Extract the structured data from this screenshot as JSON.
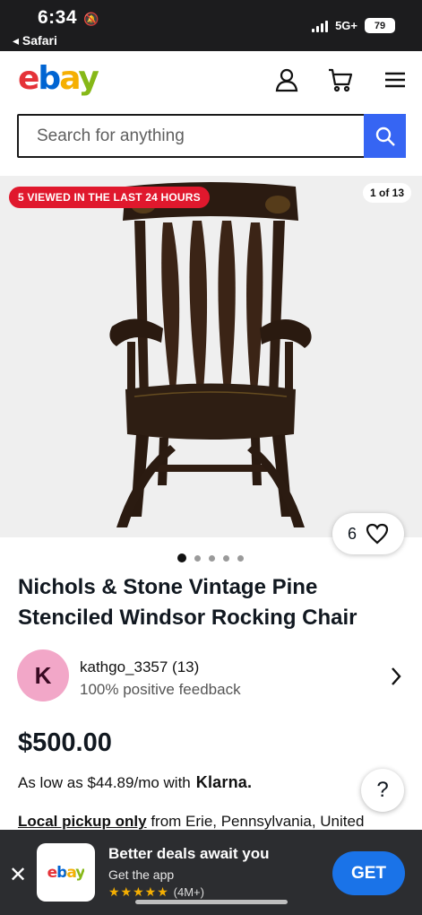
{
  "status_bar": {
    "time": "6:34",
    "back_label": "◂ Safari",
    "network": "5G+",
    "battery": "79"
  },
  "header": {
    "logo_letters": [
      "e",
      "b",
      "a",
      "y"
    ],
    "search_placeholder": "Search for anything"
  },
  "gallery": {
    "badge": "5 VIEWED IN THE LAST 24 HOURS",
    "counter": "1 of 13",
    "watch_count": "6",
    "dots_total": 5,
    "dots_active": 1
  },
  "listing": {
    "title": "Nichols & Stone Vintage Pine Stenciled Windsor Rocking Chair",
    "seller_initial": "K",
    "seller_name": "kathgo_3357 (13)",
    "seller_feedback": "100% positive feedback",
    "price": "$500.00",
    "financing_text": "As low as $44.89/mo with",
    "financing_brand": "Klarna.",
    "pickup_label": "Local pickup only",
    "pickup_rest": " from Erie, Pennsylvania, United"
  },
  "app_banner": {
    "logo_text": "ebay",
    "headline": "Better deals await you",
    "subtext": "Get the app",
    "stars": "★★★★★",
    "rating_count": "(4M+)",
    "get_label": "GET"
  },
  "colors": {
    "ebay_red": "#e53238",
    "ebay_blue": "#0064d2",
    "ebay_yellow": "#f5af02",
    "ebay_green": "#86b817",
    "search_button": "#3665f3",
    "badge_red": "#e0182d",
    "get_button": "#1a73e8"
  },
  "icons": [
    "bell-slash-icon",
    "signal-icon",
    "wifi-icon",
    "battery-icon",
    "user-icon",
    "cart-icon",
    "menu-icon",
    "search-icon",
    "heart-icon",
    "chevron-right-icon",
    "help-icon",
    "close-icon",
    "star-icon"
  ]
}
